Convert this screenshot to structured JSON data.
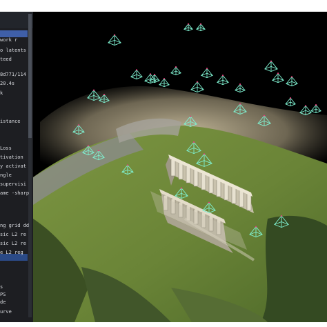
{
  "panel": {
    "rows": [
      "work  r",
      "o latents",
      "teed",
      "8d771/114",
      "20.4s",
      "k",
      "istance",
      "",
      "Loss",
      "tivation",
      "y activat",
      "ngle",
      "supervisi",
      "ame -sharp",
      "",
      "ng grid dd",
      "sic L2 re",
      "sic L2 re",
      "e L2 reg",
      "",
      "",
      "s",
      "PS",
      "de",
      "urve"
    ]
  },
  "viewport": {
    "scene": "photogrammetry point cloud of ancient temple ruins with camera frustums",
    "camera_frustum_count": 33,
    "colors": {
      "frustum": "#7ff0d0",
      "frustum_apex": "#e0407a",
      "background": "#000000",
      "grass": "#6e8a3a",
      "stone": "#d9d3c2"
    }
  }
}
